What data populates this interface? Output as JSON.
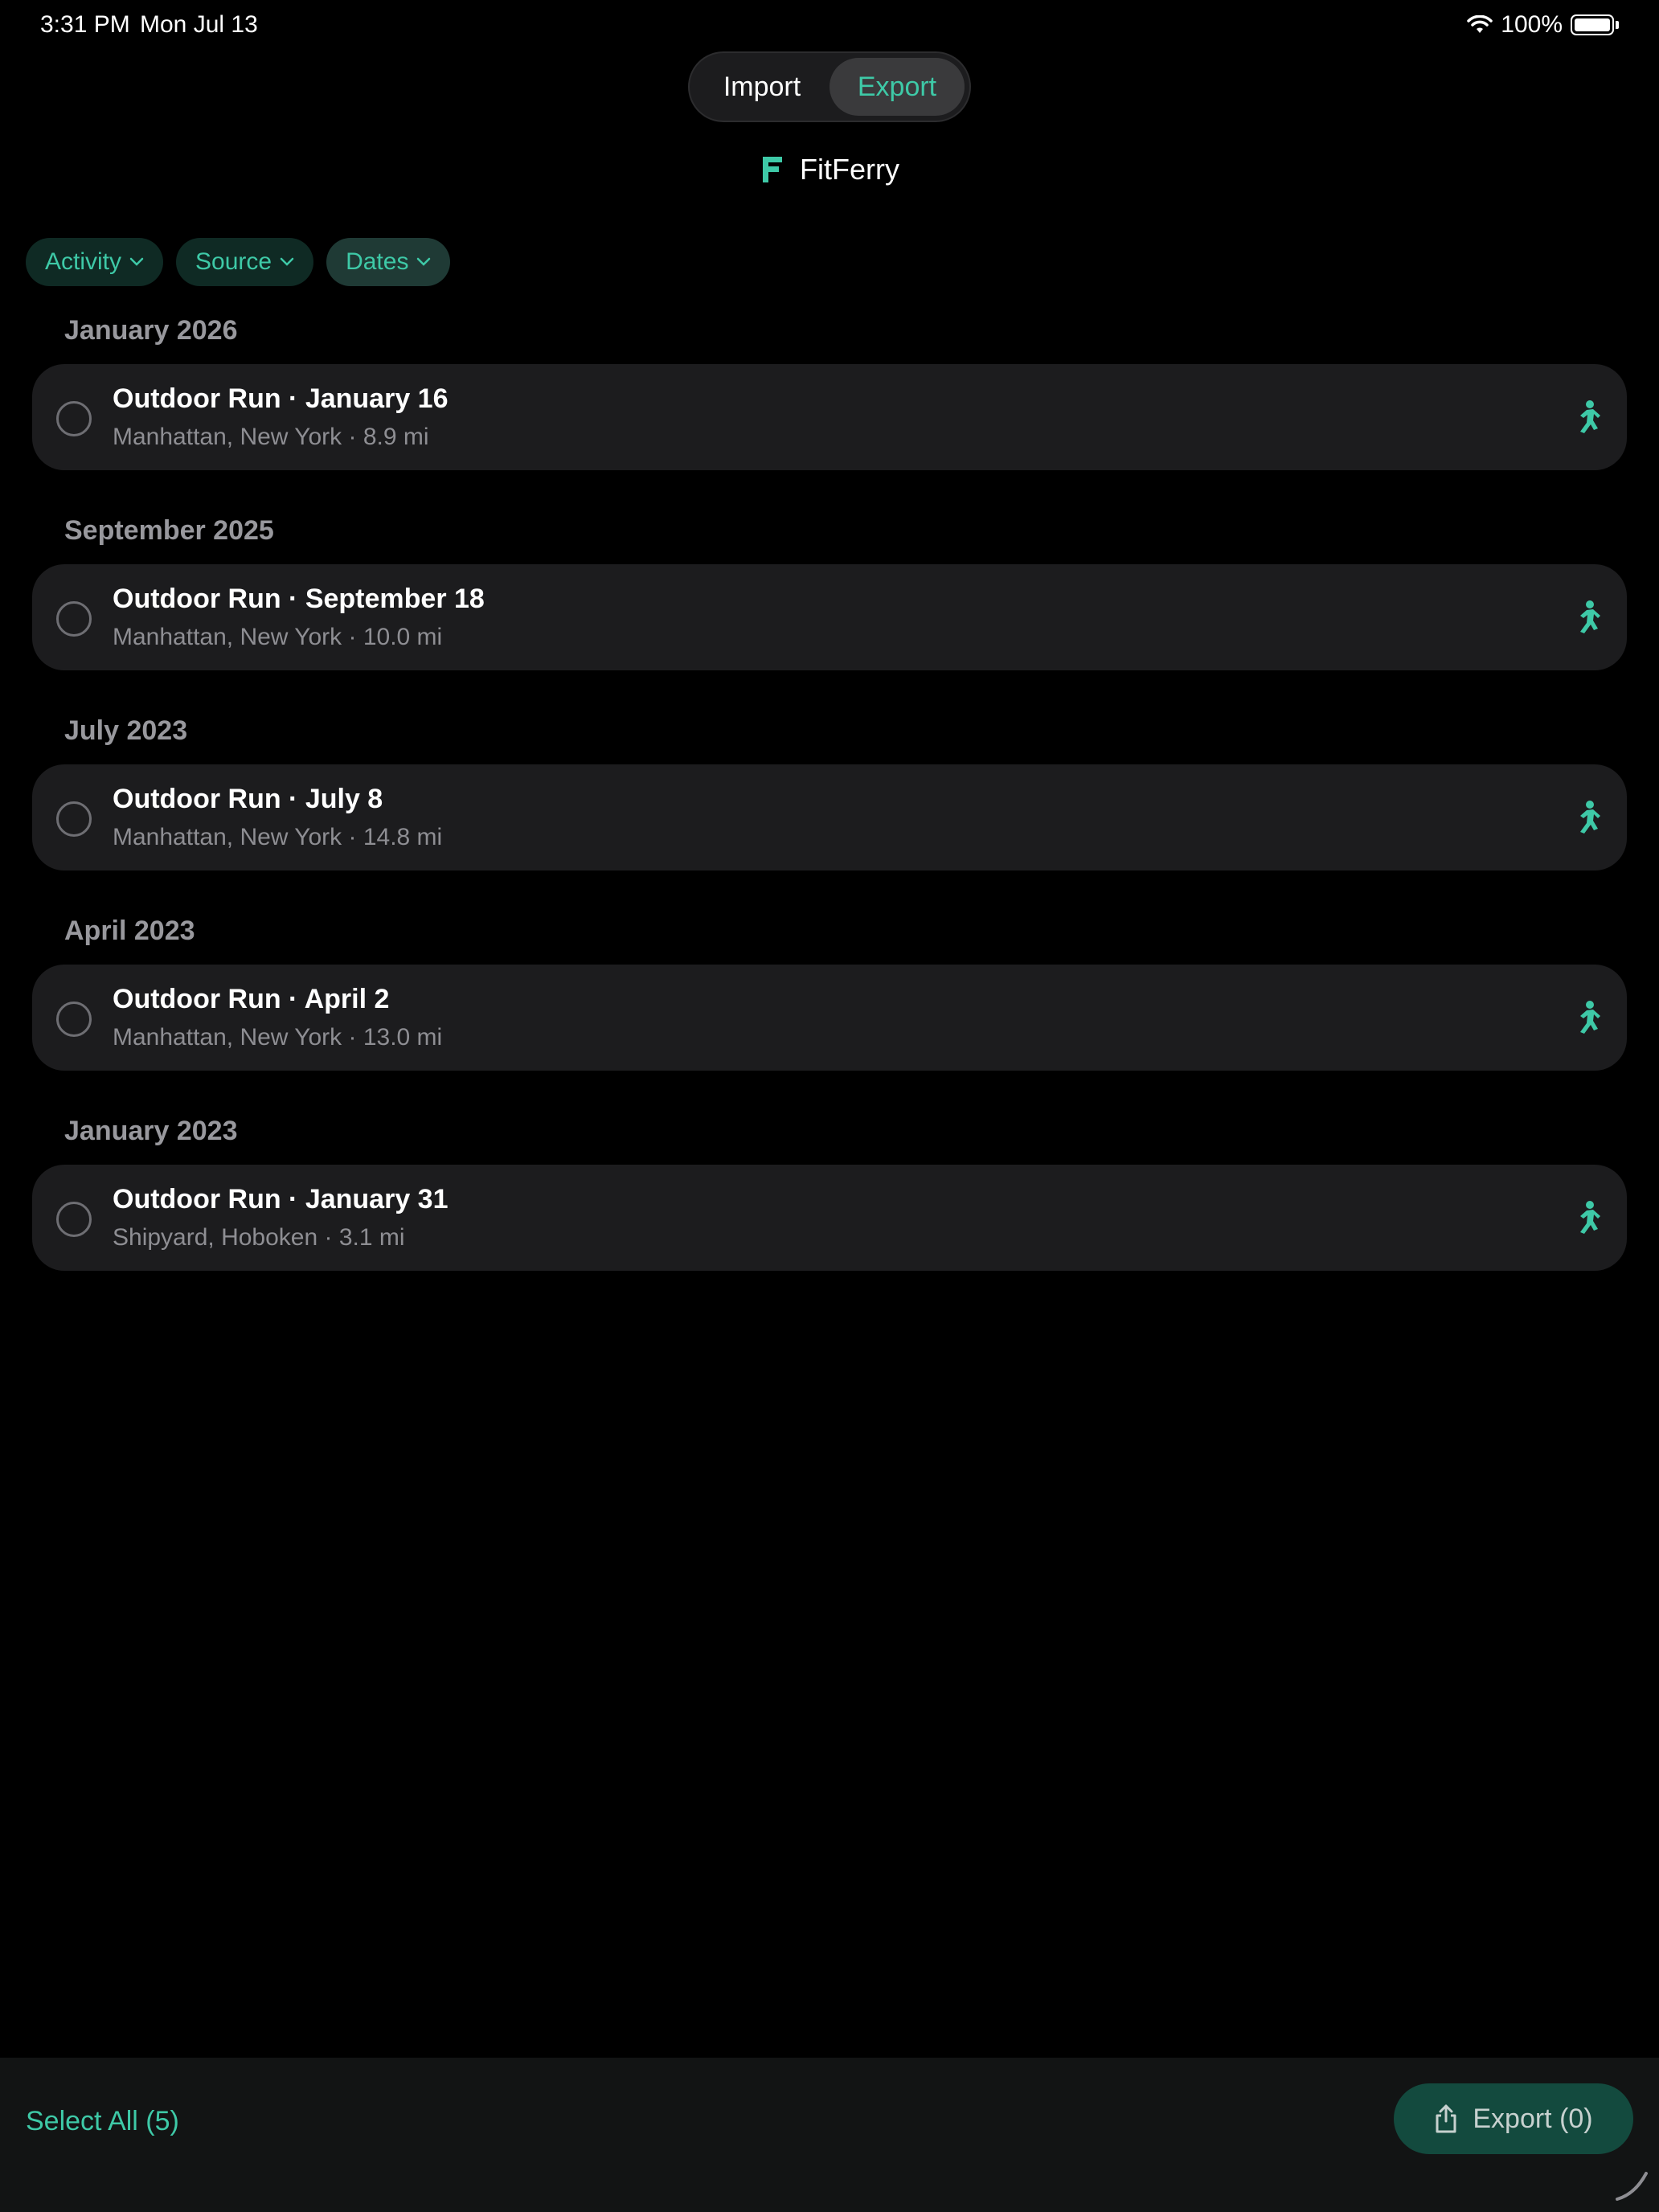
{
  "status": {
    "time": "3:31 PM",
    "date": "Mon Jul 13",
    "battery": "100%"
  },
  "segmented": {
    "import": "Import",
    "export": "Export",
    "selected": "Export"
  },
  "app": {
    "name": "FitFerry"
  },
  "filters": {
    "activity": "Activity",
    "source": "Source",
    "dates": "Dates"
  },
  "sections": [
    {
      "month": "January 2026",
      "title": "Outdoor Run · January 16",
      "subtitle": "Manhattan, New York · 8.9 mi"
    },
    {
      "month": "September 2025",
      "title": "Outdoor Run · September 18",
      "subtitle": "Manhattan, New York · 10.0 mi"
    },
    {
      "month": "July 2023",
      "title": "Outdoor Run · July 8",
      "subtitle": "Manhattan, New York · 14.8 mi"
    },
    {
      "month": "April 2023",
      "title": "Outdoor Run · April 2",
      "subtitle": "Manhattan, New York · 13.0 mi"
    },
    {
      "month": "January 2023",
      "title": "Outdoor Run · January 31",
      "subtitle": "Shipyard, Hoboken · 3.1 mi"
    }
  ],
  "bottom": {
    "select_all": "Select All (5)",
    "export_button": "Export (0)"
  },
  "colors": {
    "accent": "#3ec9a7",
    "background": "#000000",
    "row_bg": "#1c1c1e"
  },
  "icons": {
    "activity": "running-figure-icon",
    "export": "share-icon"
  }
}
